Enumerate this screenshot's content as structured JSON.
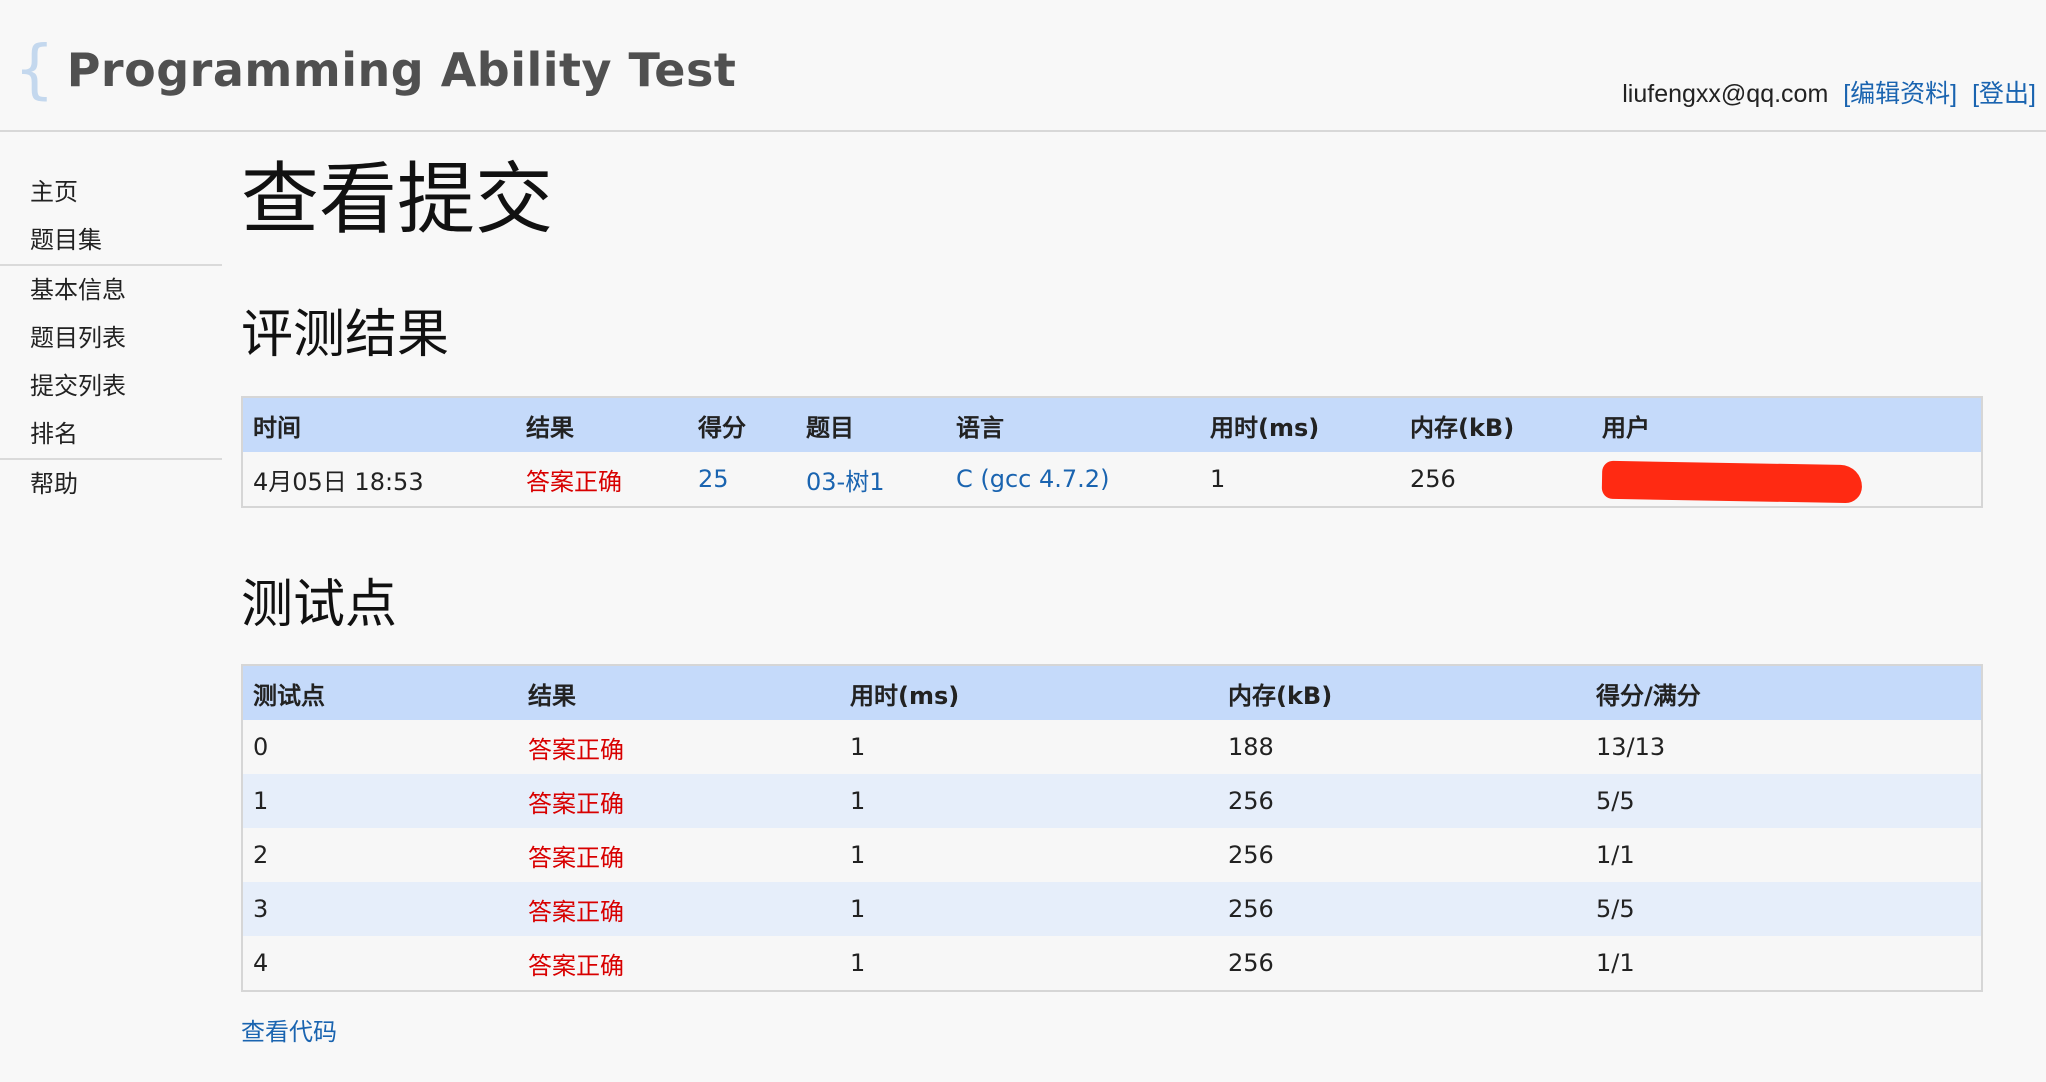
{
  "header": {
    "logo_brace": "{",
    "logo_text": "Programming Ability Test",
    "user_email": "liufengxx@qq.com",
    "edit_profile": "[编辑资料]",
    "logout": "[登出]"
  },
  "sidebar": {
    "groups": [
      [
        "主页",
        "题目集"
      ],
      [
        "基本信息",
        "题目列表",
        "提交列表",
        "排名"
      ],
      [
        "帮助"
      ]
    ]
  },
  "main": {
    "page_title": "查看提交",
    "result_section_title": "评测结果",
    "result_table": {
      "headers": [
        "时间",
        "结果",
        "得分",
        "题目",
        "语言",
        "用时(ms)",
        "内存(kB)",
        "用户"
      ],
      "row": {
        "time": "4月05日 18:53",
        "result": "答案正确",
        "score": "25",
        "problem": "03-树1",
        "language": "C (gcc 4.7.2)",
        "time_ms": "1",
        "memory_kb": "256",
        "user": ""
      }
    },
    "testcase_section_title": "测试点",
    "testcase_table": {
      "headers": [
        "测试点",
        "结果",
        "用时(ms)",
        "内存(kB)",
        "得分/满分"
      ],
      "rows": [
        [
          "0",
          "答案正确",
          "1",
          "188",
          "13/13"
        ],
        [
          "1",
          "答案正确",
          "1",
          "256",
          "5/5"
        ],
        [
          "2",
          "答案正确",
          "1",
          "256",
          "1/1"
        ],
        [
          "3",
          "答案正确",
          "1",
          "256",
          "5/5"
        ],
        [
          "4",
          "答案正确",
          "1",
          "256",
          "1/1"
        ]
      ]
    },
    "view_code_link": "查看代码"
  },
  "colors": {
    "accepted": "#d80000",
    "link": "#1a64b0",
    "header_row": "#c5dafa",
    "alt_row": "#e6eefa",
    "redaction": "#ff2a12"
  }
}
